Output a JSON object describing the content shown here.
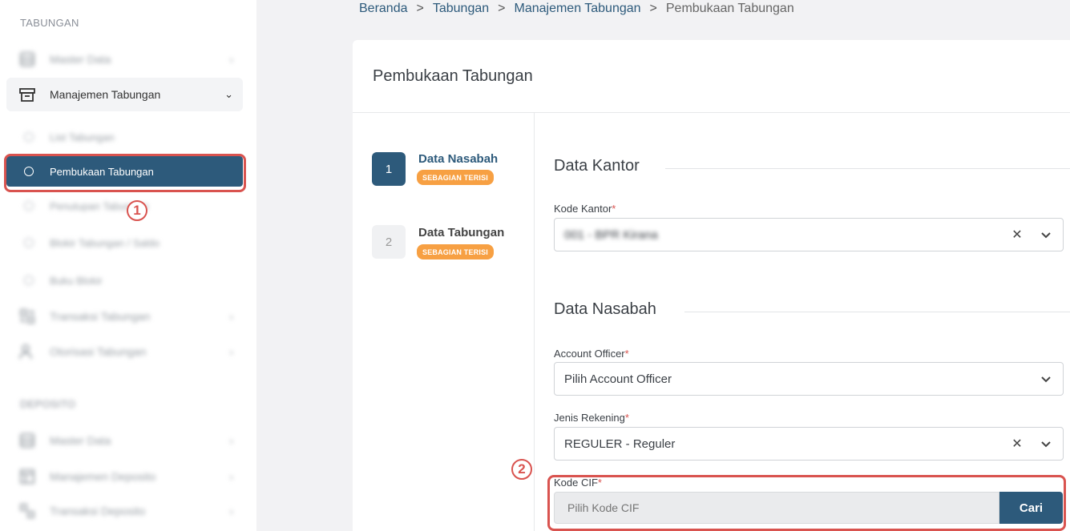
{
  "sidebar": {
    "section1": "TABUNGAN",
    "item_master": "Master Data",
    "item_manajemen": "Manajemen Tabungan",
    "sub_list": "List Tabungan",
    "sub_pembukaan": "Pembukaan Tabungan",
    "sub_penutupan": "Penutupan Tabungan",
    "sub_blokir": "Blokir Tabungan / Saldo",
    "sub_buku": "Buku Blokir",
    "item_transaksi": "Transaksi Tabungan",
    "item_otorisasi": "Otorisasi Tabungan",
    "section2": "DEPOSITO",
    "dep_master": "Master Data",
    "dep_manajemen": "Manajemen Deposito",
    "dep_transaksi": "Transaksi Deposito"
  },
  "markers": {
    "m1": "1",
    "m2": "2"
  },
  "breadcrumb": {
    "b1": "Beranda",
    "b2": "Tabungan",
    "b3": "Manajemen Tabungan",
    "b4": "Pembukaan Tabungan",
    "sep": ">"
  },
  "card": {
    "title": "Pembukaan Tabungan"
  },
  "steps": [
    {
      "num": "1",
      "name": "Data Nasabah",
      "badge": "SEBAGIAN TERISI"
    },
    {
      "num": "2",
      "name": "Data Tabungan",
      "badge": "SEBAGIAN TERISI"
    }
  ],
  "form": {
    "sect_kantor": "Data Kantor",
    "kode_kantor_label": "Kode Kantor",
    "kode_kantor_value": "001 - BPR Kirana",
    "sect_nasabah": "Data Nasabah",
    "ao_label": "Account Officer",
    "ao_value": "Pilih Account Officer",
    "jenis_label": "Jenis Rekening",
    "jenis_value": "REGULER - Reguler",
    "cif_label": "Kode CIF",
    "cif_placeholder": "Pilih Kode CIF",
    "cari": "Cari",
    "req": "*",
    "clear": "✕",
    "chevron": "⌄"
  }
}
